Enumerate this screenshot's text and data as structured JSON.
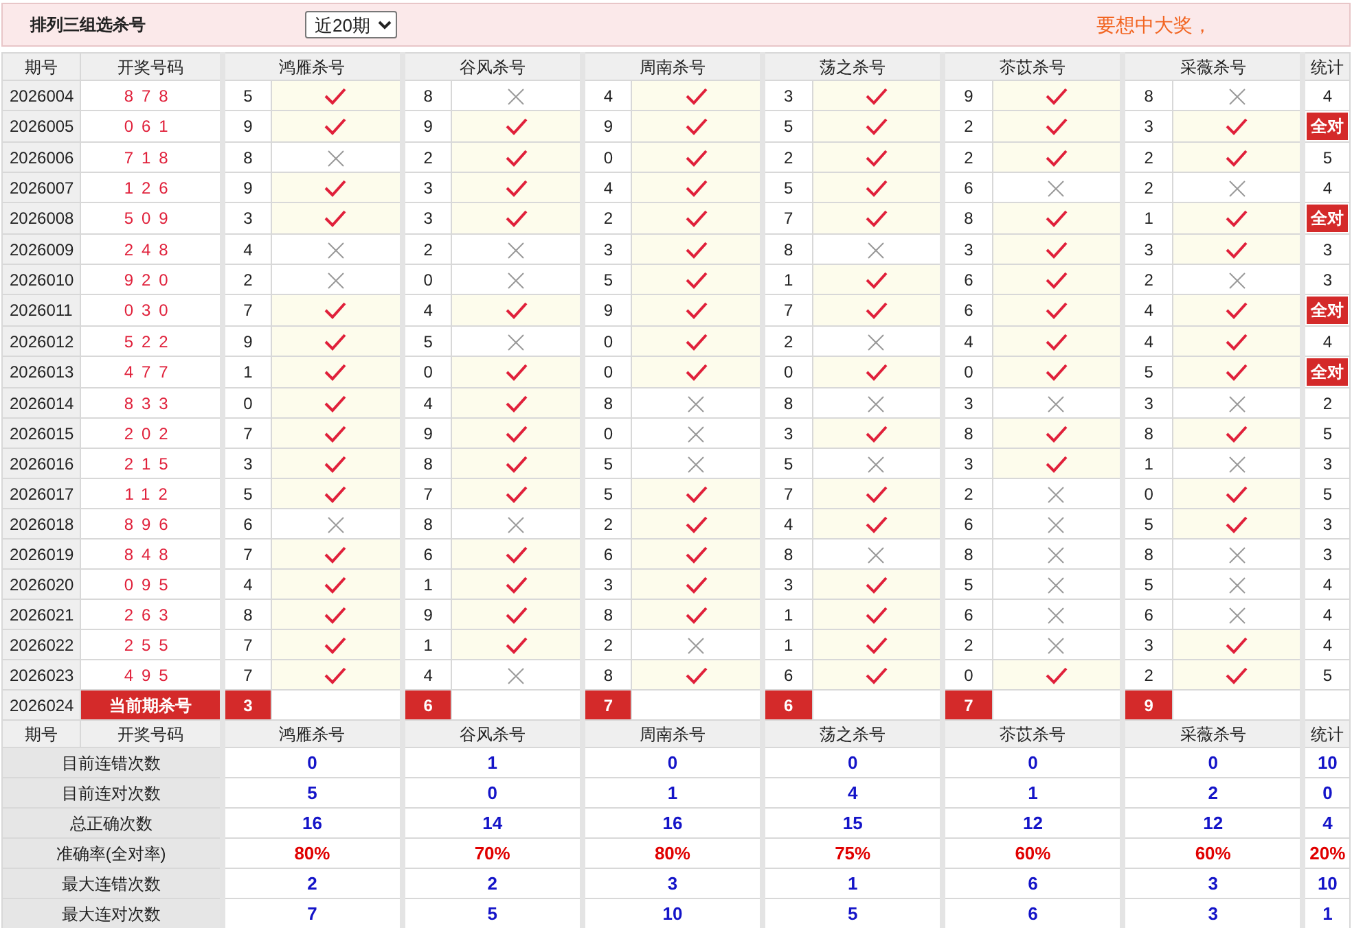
{
  "title": "排列三组选杀号",
  "period_select": {
    "value": "近20期"
  },
  "promo": "要想中大奖，",
  "columns": [
    "期号",
    "开奖号码",
    "鸿雁杀号",
    "谷风杀号",
    "周南杀号",
    "荡之杀号",
    "苶苡杀号",
    "采薇杀号",
    "统计"
  ],
  "rows": [
    {
      "period": "2026004",
      "draw": "878",
      "picks": [
        {
          "num": "5",
          "hit": true
        },
        {
          "num": "8",
          "hit": false
        },
        {
          "num": "4",
          "hit": true
        },
        {
          "num": "3",
          "hit": true
        },
        {
          "num": "9",
          "hit": true
        },
        {
          "num": "8",
          "hit": false
        }
      ],
      "stat": {
        "kind": "count",
        "text": "4"
      }
    },
    {
      "period": "2026005",
      "draw": "061",
      "picks": [
        {
          "num": "9",
          "hit": true
        },
        {
          "num": "9",
          "hit": true
        },
        {
          "num": "9",
          "hit": true
        },
        {
          "num": "5",
          "hit": true
        },
        {
          "num": "2",
          "hit": true
        },
        {
          "num": "3",
          "hit": true
        }
      ],
      "stat": {
        "kind": "badge",
        "text": "全对"
      }
    },
    {
      "period": "2026006",
      "draw": "718",
      "picks": [
        {
          "num": "8",
          "hit": false
        },
        {
          "num": "2",
          "hit": true
        },
        {
          "num": "0",
          "hit": true
        },
        {
          "num": "2",
          "hit": true
        },
        {
          "num": "2",
          "hit": true
        },
        {
          "num": "2",
          "hit": true
        }
      ],
      "stat": {
        "kind": "count",
        "text": "5"
      }
    },
    {
      "period": "2026007",
      "draw": "126",
      "picks": [
        {
          "num": "9",
          "hit": true
        },
        {
          "num": "3",
          "hit": true
        },
        {
          "num": "4",
          "hit": true
        },
        {
          "num": "5",
          "hit": true
        },
        {
          "num": "6",
          "hit": false
        },
        {
          "num": "2",
          "hit": false
        }
      ],
      "stat": {
        "kind": "count",
        "text": "4"
      }
    },
    {
      "period": "2026008",
      "draw": "509",
      "picks": [
        {
          "num": "3",
          "hit": true
        },
        {
          "num": "3",
          "hit": true
        },
        {
          "num": "2",
          "hit": true
        },
        {
          "num": "7",
          "hit": true
        },
        {
          "num": "8",
          "hit": true
        },
        {
          "num": "1",
          "hit": true
        }
      ],
      "stat": {
        "kind": "badge",
        "text": "全对"
      }
    },
    {
      "period": "2026009",
      "draw": "248",
      "picks": [
        {
          "num": "4",
          "hit": false
        },
        {
          "num": "2",
          "hit": false
        },
        {
          "num": "3",
          "hit": true
        },
        {
          "num": "8",
          "hit": false
        },
        {
          "num": "3",
          "hit": true
        },
        {
          "num": "3",
          "hit": true
        }
      ],
      "stat": {
        "kind": "count",
        "text": "3"
      }
    },
    {
      "period": "2026010",
      "draw": "920",
      "picks": [
        {
          "num": "2",
          "hit": false
        },
        {
          "num": "0",
          "hit": false
        },
        {
          "num": "5",
          "hit": true
        },
        {
          "num": "1",
          "hit": true
        },
        {
          "num": "6",
          "hit": true
        },
        {
          "num": "2",
          "hit": false
        }
      ],
      "stat": {
        "kind": "count",
        "text": "3"
      }
    },
    {
      "period": "2026011",
      "draw": "030",
      "picks": [
        {
          "num": "7",
          "hit": true
        },
        {
          "num": "4",
          "hit": true
        },
        {
          "num": "9",
          "hit": true
        },
        {
          "num": "7",
          "hit": true
        },
        {
          "num": "6",
          "hit": true
        },
        {
          "num": "4",
          "hit": true
        }
      ],
      "stat": {
        "kind": "badge",
        "text": "全对"
      }
    },
    {
      "period": "2026012",
      "draw": "522",
      "picks": [
        {
          "num": "9",
          "hit": true
        },
        {
          "num": "5",
          "hit": false
        },
        {
          "num": "0",
          "hit": true
        },
        {
          "num": "2",
          "hit": false
        },
        {
          "num": "4",
          "hit": true
        },
        {
          "num": "4",
          "hit": true
        }
      ],
      "stat": {
        "kind": "count",
        "text": "4"
      }
    },
    {
      "period": "2026013",
      "draw": "477",
      "picks": [
        {
          "num": "1",
          "hit": true
        },
        {
          "num": "0",
          "hit": true
        },
        {
          "num": "0",
          "hit": true
        },
        {
          "num": "0",
          "hit": true
        },
        {
          "num": "0",
          "hit": true
        },
        {
          "num": "5",
          "hit": true
        }
      ],
      "stat": {
        "kind": "badge",
        "text": "全对"
      }
    },
    {
      "period": "2026014",
      "draw": "833",
      "picks": [
        {
          "num": "0",
          "hit": true
        },
        {
          "num": "4",
          "hit": true
        },
        {
          "num": "8",
          "hit": false
        },
        {
          "num": "8",
          "hit": false
        },
        {
          "num": "3",
          "hit": false
        },
        {
          "num": "3",
          "hit": false
        }
      ],
      "stat": {
        "kind": "count",
        "text": "2"
      }
    },
    {
      "period": "2026015",
      "draw": "202",
      "picks": [
        {
          "num": "7",
          "hit": true
        },
        {
          "num": "9",
          "hit": true
        },
        {
          "num": "0",
          "hit": false
        },
        {
          "num": "3",
          "hit": true
        },
        {
          "num": "8",
          "hit": true
        },
        {
          "num": "8",
          "hit": true
        }
      ],
      "stat": {
        "kind": "count",
        "text": "5"
      }
    },
    {
      "period": "2026016",
      "draw": "215",
      "picks": [
        {
          "num": "3",
          "hit": true
        },
        {
          "num": "8",
          "hit": true
        },
        {
          "num": "5",
          "hit": false
        },
        {
          "num": "5",
          "hit": false
        },
        {
          "num": "3",
          "hit": true
        },
        {
          "num": "1",
          "hit": false
        }
      ],
      "stat": {
        "kind": "count",
        "text": "3"
      }
    },
    {
      "period": "2026017",
      "draw": "112",
      "picks": [
        {
          "num": "5",
          "hit": true
        },
        {
          "num": "7",
          "hit": true
        },
        {
          "num": "5",
          "hit": true
        },
        {
          "num": "7",
          "hit": true
        },
        {
          "num": "2",
          "hit": false
        },
        {
          "num": "0",
          "hit": true
        }
      ],
      "stat": {
        "kind": "count",
        "text": "5"
      }
    },
    {
      "period": "2026018",
      "draw": "896",
      "picks": [
        {
          "num": "6",
          "hit": false
        },
        {
          "num": "8",
          "hit": false
        },
        {
          "num": "2",
          "hit": true
        },
        {
          "num": "4",
          "hit": true
        },
        {
          "num": "6",
          "hit": false
        },
        {
          "num": "5",
          "hit": true
        }
      ],
      "stat": {
        "kind": "count",
        "text": "3"
      }
    },
    {
      "period": "2026019",
      "draw": "848",
      "picks": [
        {
          "num": "7",
          "hit": true
        },
        {
          "num": "6",
          "hit": true
        },
        {
          "num": "6",
          "hit": true
        },
        {
          "num": "8",
          "hit": false
        },
        {
          "num": "8",
          "hit": false
        },
        {
          "num": "8",
          "hit": false
        }
      ],
      "stat": {
        "kind": "count",
        "text": "3"
      }
    },
    {
      "period": "2026020",
      "draw": "095",
      "picks": [
        {
          "num": "4",
          "hit": true
        },
        {
          "num": "1",
          "hit": true
        },
        {
          "num": "3",
          "hit": true
        },
        {
          "num": "3",
          "hit": true
        },
        {
          "num": "5",
          "hit": false
        },
        {
          "num": "5",
          "hit": false
        }
      ],
      "stat": {
        "kind": "count",
        "text": "4"
      }
    },
    {
      "period": "2026021",
      "draw": "263",
      "picks": [
        {
          "num": "8",
          "hit": true
        },
        {
          "num": "9",
          "hit": true
        },
        {
          "num": "8",
          "hit": true
        },
        {
          "num": "1",
          "hit": true
        },
        {
          "num": "6",
          "hit": false
        },
        {
          "num": "6",
          "hit": false
        }
      ],
      "stat": {
        "kind": "count",
        "text": "4"
      }
    },
    {
      "period": "2026022",
      "draw": "255",
      "picks": [
        {
          "num": "7",
          "hit": true
        },
        {
          "num": "1",
          "hit": true
        },
        {
          "num": "2",
          "hit": false
        },
        {
          "num": "1",
          "hit": true
        },
        {
          "num": "2",
          "hit": false
        },
        {
          "num": "3",
          "hit": true
        }
      ],
      "stat": {
        "kind": "count",
        "text": "4"
      }
    },
    {
      "period": "2026023",
      "draw": "495",
      "picks": [
        {
          "num": "7",
          "hit": true
        },
        {
          "num": "4",
          "hit": false
        },
        {
          "num": "8",
          "hit": true
        },
        {
          "num": "6",
          "hit": true
        },
        {
          "num": "0",
          "hit": true
        },
        {
          "num": "2",
          "hit": true
        }
      ],
      "stat": {
        "kind": "count",
        "text": "5"
      }
    }
  ],
  "current": {
    "period": "2026024",
    "label": "当前期杀号",
    "picks": [
      "3",
      "6",
      "7",
      "6",
      "7",
      "9"
    ]
  },
  "summary_columns": [
    "期号",
    "开奖号码",
    "鸿雁杀号",
    "谷风杀号",
    "周南杀号",
    "荡之杀号",
    "苶苡杀号",
    "采薇杀号",
    "统计"
  ],
  "summary": [
    {
      "label": "目前连错次数",
      "kind": "count",
      "values": [
        "0",
        "1",
        "0",
        "0",
        "0",
        "0",
        "10"
      ]
    },
    {
      "label": "目前连对次数",
      "kind": "count",
      "values": [
        "5",
        "0",
        "1",
        "4",
        "1",
        "2",
        "0"
      ]
    },
    {
      "label": "总正确次数",
      "kind": "count",
      "values": [
        "16",
        "14",
        "16",
        "15",
        "12",
        "12",
        "4"
      ]
    },
    {
      "label": "准确率(全对率)",
      "kind": "percent",
      "values": [
        "80%",
        "70%",
        "80%",
        "75%",
        "60%",
        "60%",
        "20%"
      ]
    },
    {
      "label": "最大连错次数",
      "kind": "count",
      "values": [
        "2",
        "2",
        "3",
        "1",
        "6",
        "3",
        "10"
      ]
    },
    {
      "label": "最大连对次数",
      "kind": "count",
      "values": [
        "7",
        "5",
        "10",
        "5",
        "6",
        "3",
        "1"
      ]
    }
  ]
}
